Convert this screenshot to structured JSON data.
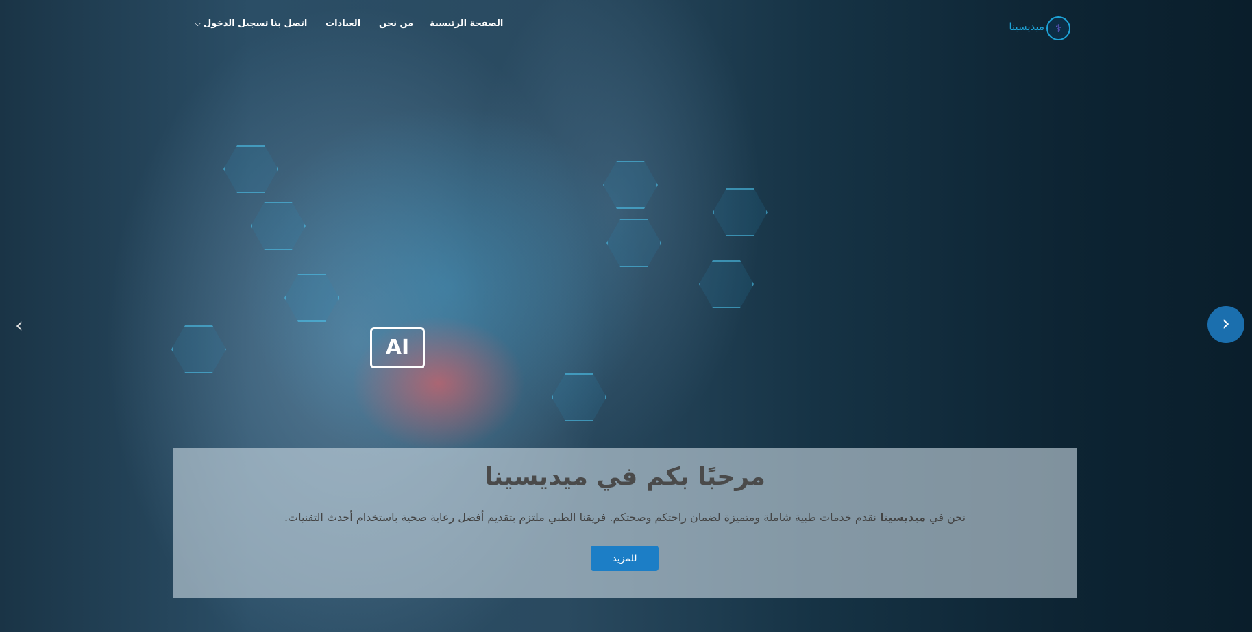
{
  "brand": {
    "name": "ميديسينا",
    "logo_glyph": "⚕"
  },
  "nav": {
    "home": "الصفحة الرئيسية",
    "about": "من نحن",
    "clinics": "العيادات",
    "contact": "اتصل بنا",
    "login": "تسجيل الدخول",
    "login_caret": "⌵"
  },
  "hero": {
    "title": "مرحبًا بكم في ميديسينا",
    "text_prefix": "نحن في ",
    "text_brand": "ميديسينا",
    "text_suffix": " نقدم خدمات طبية شاملة ومتميزة لضمان راحتكم وصحتكم. فريقنا الطبي ملتزم بتقديم أفضل رعاية صحية باستخدام أحدث التقنيات.",
    "button": "للمزيد",
    "image_label": "AI"
  },
  "carousel": {
    "prev": "‹",
    "next": "›"
  }
}
